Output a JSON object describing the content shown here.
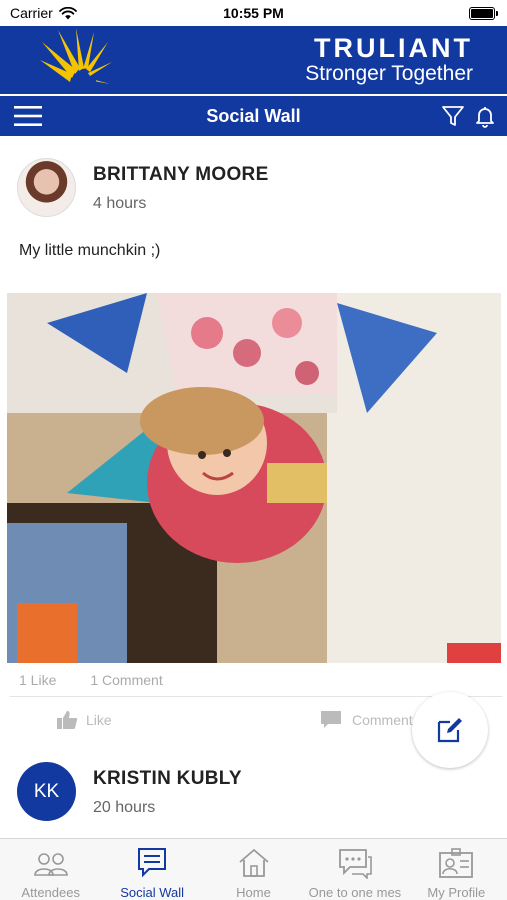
{
  "status_bar": {
    "carrier": "Carrier",
    "time": "10:55 PM"
  },
  "brand": {
    "name": "TRULIANT",
    "tagline": "Stronger Together",
    "color": "#1239a0",
    "accent": "#f5c400"
  },
  "nav": {
    "title": "Social Wall",
    "left_icon": "menu-icon",
    "right_icons": [
      "filter-icon",
      "bell-icon"
    ]
  },
  "posts": [
    {
      "author": "BRITTANY MOORE",
      "time": "4 hours",
      "text": "My little munchkin ;)",
      "likes": "1 Like",
      "comments": "1 Comment",
      "like_label": "Like",
      "comment_label": "Comment"
    },
    {
      "author": "KRISTIN KUBLY",
      "initials": "KK",
      "time": "20 hours"
    }
  ],
  "tabs": [
    {
      "label": "Attendees",
      "icon": "attendees-icon"
    },
    {
      "label": "Social Wall",
      "icon": "social-wall-icon",
      "active": true
    },
    {
      "label": "Home",
      "icon": "home-icon"
    },
    {
      "label": "One to one mes",
      "icon": "chat-icon"
    },
    {
      "label": "My Profile",
      "icon": "profile-icon"
    }
  ]
}
